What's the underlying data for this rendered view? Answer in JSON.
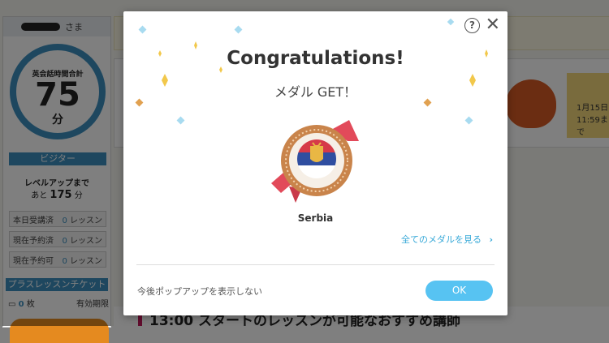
{
  "background": {
    "sidebar": {
      "user_suffix": "さま",
      "total_time_label": "英会話時間合計",
      "total_time_value": "75",
      "total_time_unit": "分",
      "rank": "ビジター",
      "level_up_label": "レベルアップまで",
      "level_up_prefix": "あと",
      "level_up_value": "175",
      "level_up_unit": "分",
      "stats": [
        {
          "label": "本日受講済",
          "value": "0",
          "unit": "レッスン"
        },
        {
          "label": "現在予約済",
          "value": "0",
          "unit": "レッスン"
        },
        {
          "label": "現在予約可",
          "value": "0",
          "unit": "レッスン"
        }
      ],
      "ticket_header": "プラスレッスンチケット",
      "ticket_count": "0",
      "ticket_unit": "枚",
      "ticket_expiry": "有効期限"
    },
    "card_date_line1": "1月15日",
    "card_date_line2": "11:59まで",
    "bottom_text": "13:00 スタートのレッスンが可能なおすすめ講師"
  },
  "modal": {
    "help_label": "?",
    "close_label": "✕",
    "title": "Congratulations!",
    "subtitle": "メダル GET！",
    "medal_name": "Serbia",
    "all_medals_link": "全てのメダルを見る",
    "no_show_label": "今後ポップアップを表示しない",
    "ok_label": "OK"
  },
  "colors": {
    "accent_blue": "#3d8fbf",
    "ok_button": "#57c3f2",
    "medal_bronze": "#c9844b",
    "ribbon": "#e24a5a"
  },
  "icons": {
    "help": "help-circle-icon",
    "close": "close-icon",
    "link_arrow": "chevron-right-icon",
    "medal": "serbia-medal-icon",
    "confetti": "confetti-icon"
  }
}
